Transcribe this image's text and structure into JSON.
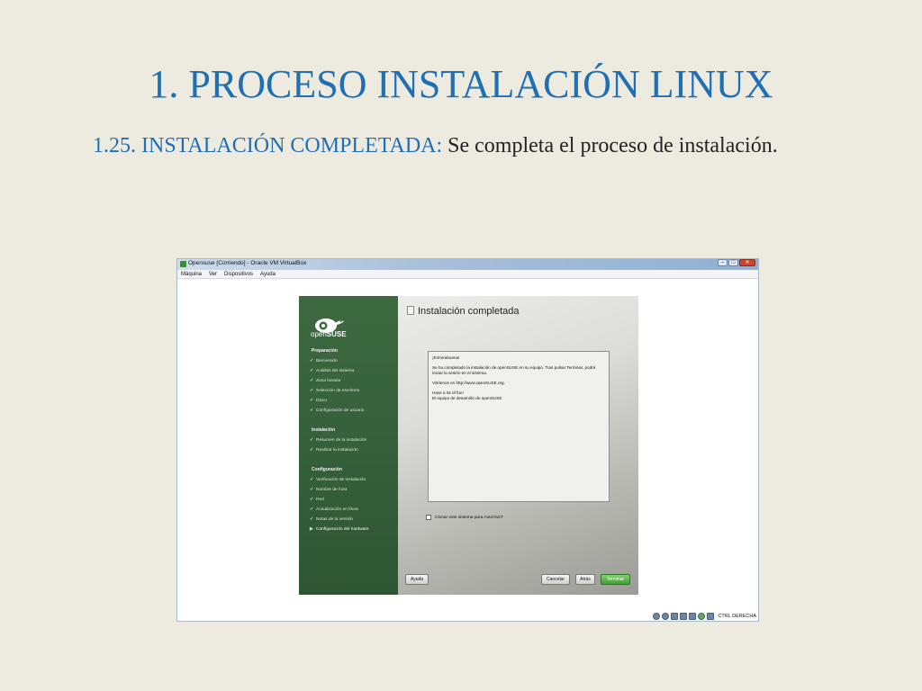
{
  "slide": {
    "title": "1. PROCESO INSTALACIÓN LINUX",
    "subtitle_label": "1.25. INSTALACIÓN COMPLETADA:",
    "subtitle_text": "Se completa el proceso de instalación."
  },
  "vbox": {
    "window_title": "Opensuse [Corriendo] - Oracle VM VirtualBox",
    "menu": [
      "Máquina",
      "Ver",
      "Dispositivos",
      "Ayuda"
    ],
    "status_text": "CTRL DERECHA"
  },
  "installer": {
    "logo_text_open": "open",
    "logo_text_suse": "SUSE",
    "sections": [
      {
        "title": "Preparación",
        "items": [
          "Bienvenido",
          "Análisis del sistema",
          "Zona horaria",
          "Selección de escritorio",
          "Disco",
          "Configuración de usuario"
        ]
      },
      {
        "title": "Instalación",
        "items": [
          "Resumen de la instalación",
          "Realizar la instalación"
        ]
      },
      {
        "title": "Configuración",
        "items": [
          "Verificación de instalación",
          "Nombre de host",
          "Red",
          "Actualización en línea",
          "Notas de la versión",
          "Configuración del hardware"
        ]
      }
    ],
    "title": "Instalación completada",
    "message": [
      "¡Enhorabuena!",
      "Se ha completado la instalación de openSUSE en su equipo. Tras pulsar Terminar, podrá iniciar la sesión en el sistema.",
      "Visítenos en http://www.openSUSE.org.",
      "Have a lot of fun!",
      "El equipo de desarrollo de openSUSE"
    ],
    "clone_checkbox": "Clonar este sistema para AutoYaST",
    "buttons": {
      "help": "Ayuda",
      "cancel": "Cancelar",
      "back": "Atrás",
      "finish": "Terminar"
    }
  }
}
